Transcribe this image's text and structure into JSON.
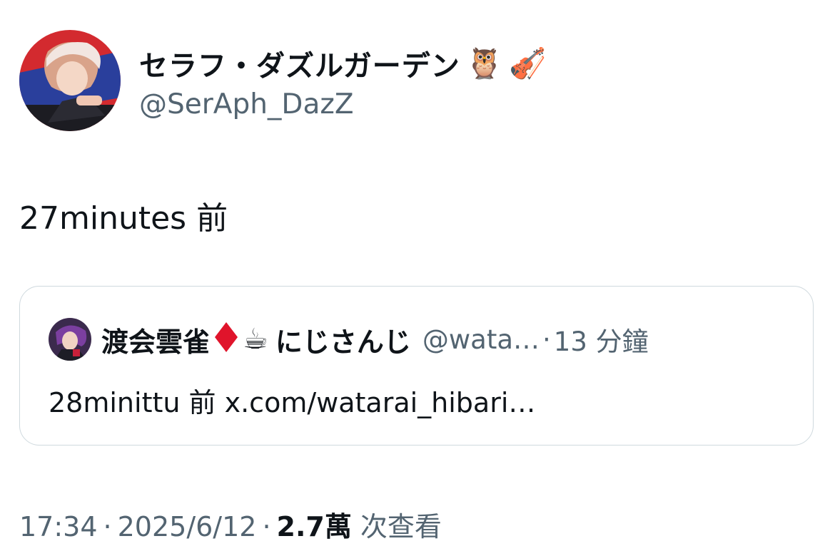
{
  "author": {
    "display_name": "セラフ・ダズルガーデン",
    "handle": "@SerAph_DazZ",
    "name_icons": [
      "owl-icon",
      "violin-icon"
    ],
    "avatar_icon": "author-avatar"
  },
  "tweet": {
    "text": "27minutes 前"
  },
  "quote": {
    "avatar_icon": "quote-author-avatar",
    "display_name": "渡会雲雀",
    "name_icons": [
      "red-diamond-icon",
      "coffee-cup-icon"
    ],
    "name_suffix": "にじさんじ",
    "handle": "@wata…",
    "separator": "·",
    "time": "13 分鐘",
    "text": "28minittu 前 x.com/watarai_hibari…"
  },
  "meta": {
    "time": "17:34",
    "sep1": "·",
    "date": "2025/6/12",
    "sep2": "·",
    "views_count": "2.7萬",
    "views_label": "次查看"
  },
  "colors": {
    "text": "#0f1419",
    "secondary": "#536471",
    "border": "#cfd9de",
    "diamond": "#e0142b"
  }
}
